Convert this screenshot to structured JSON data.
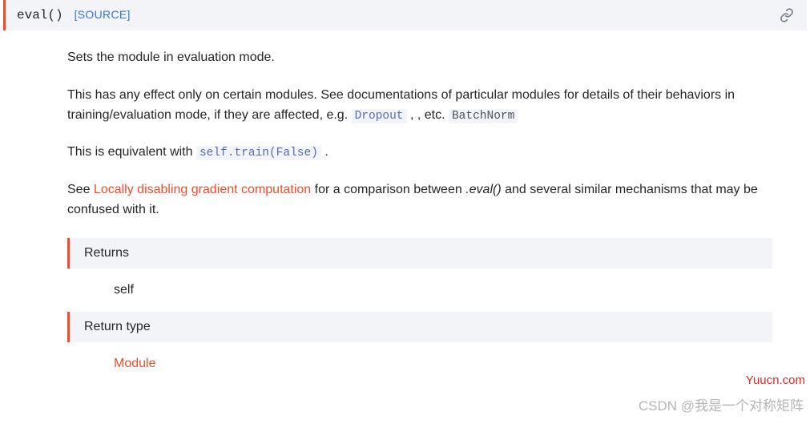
{
  "signature": {
    "name": "eval()",
    "source_label": "[SOURCE]"
  },
  "paragraphs": {
    "p1": "Sets the module in evaluation mode.",
    "p2a": "This has any effect only on certain modules. See documentations of particular modules for details of their behaviors in training/evaluation mode, if they are affected, e.g. ",
    "p2_code1": "Dropout",
    "p2b": " , , etc. ",
    "p2_code2": "BatchNorm",
    "p3a": "This is equivalent with ",
    "p3_code": "self.train(False)",
    "p3b": " .",
    "p4a": "See ",
    "p4_link": "Locally disabling gradient computation",
    "p4b": " for a comparison between ",
    "p4_em": ".eval()",
    "p4c": " and several similar mechanisms that may be confused with it."
  },
  "fields": {
    "returns_label": "Returns",
    "returns_value": "self",
    "return_type_label": "Return type",
    "return_type_value": "Module"
  },
  "watermarks": {
    "site": "Yuucn.com",
    "author": "CSDN @我是一个对称矩阵"
  }
}
